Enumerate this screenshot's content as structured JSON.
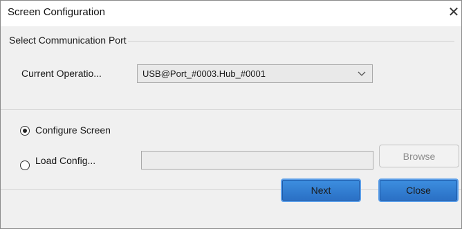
{
  "window": {
    "title": "Screen Configuration",
    "close_glyph": "✕"
  },
  "port_group": {
    "label": "Select Communication Port",
    "operation_label": "Current Operatio...",
    "operation_value": "USB@Port_#0003.Hub_#0001"
  },
  "options": {
    "configure_screen": {
      "label": "Configure Screen",
      "checked": true
    },
    "load_config": {
      "label": "Load Config...",
      "checked": false
    },
    "browse_label": "Browse"
  },
  "buttons": {
    "next_label": "Next",
    "close_label": "Close"
  },
  "icons": {
    "dropdown": "chevron-down-icon",
    "close": "close-icon"
  }
}
